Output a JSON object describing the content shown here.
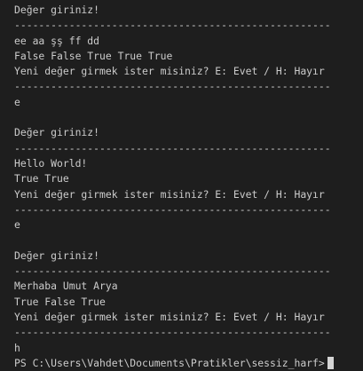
{
  "terminal": {
    "separator": "----------------------------------------------------",
    "prompt": "PS C:\\Users\\Vahdet\\Documents\\Pratikler\\sessiz_harf>",
    "blocks": [
      {
        "ask": "Değer giriniz!",
        "input": "ee aa şş ff dd",
        "result": "False False True True True",
        "again": "Yeni değer girmek ister misiniz? E: Evet / H: Hayır",
        "answer": "e"
      },
      {
        "ask": "Değer giriniz!",
        "input": "Hello World!",
        "result": "True True",
        "again": "Yeni değer girmek ister misiniz? E: Evet / H: Hayır",
        "answer": "e"
      },
      {
        "ask": "Değer giriniz!",
        "input": "Merhaba Umut Arya",
        "result": "True False True",
        "again": "Yeni değer girmek ister misiniz? E: Evet / H: Hayır",
        "answer": "h"
      }
    ]
  }
}
